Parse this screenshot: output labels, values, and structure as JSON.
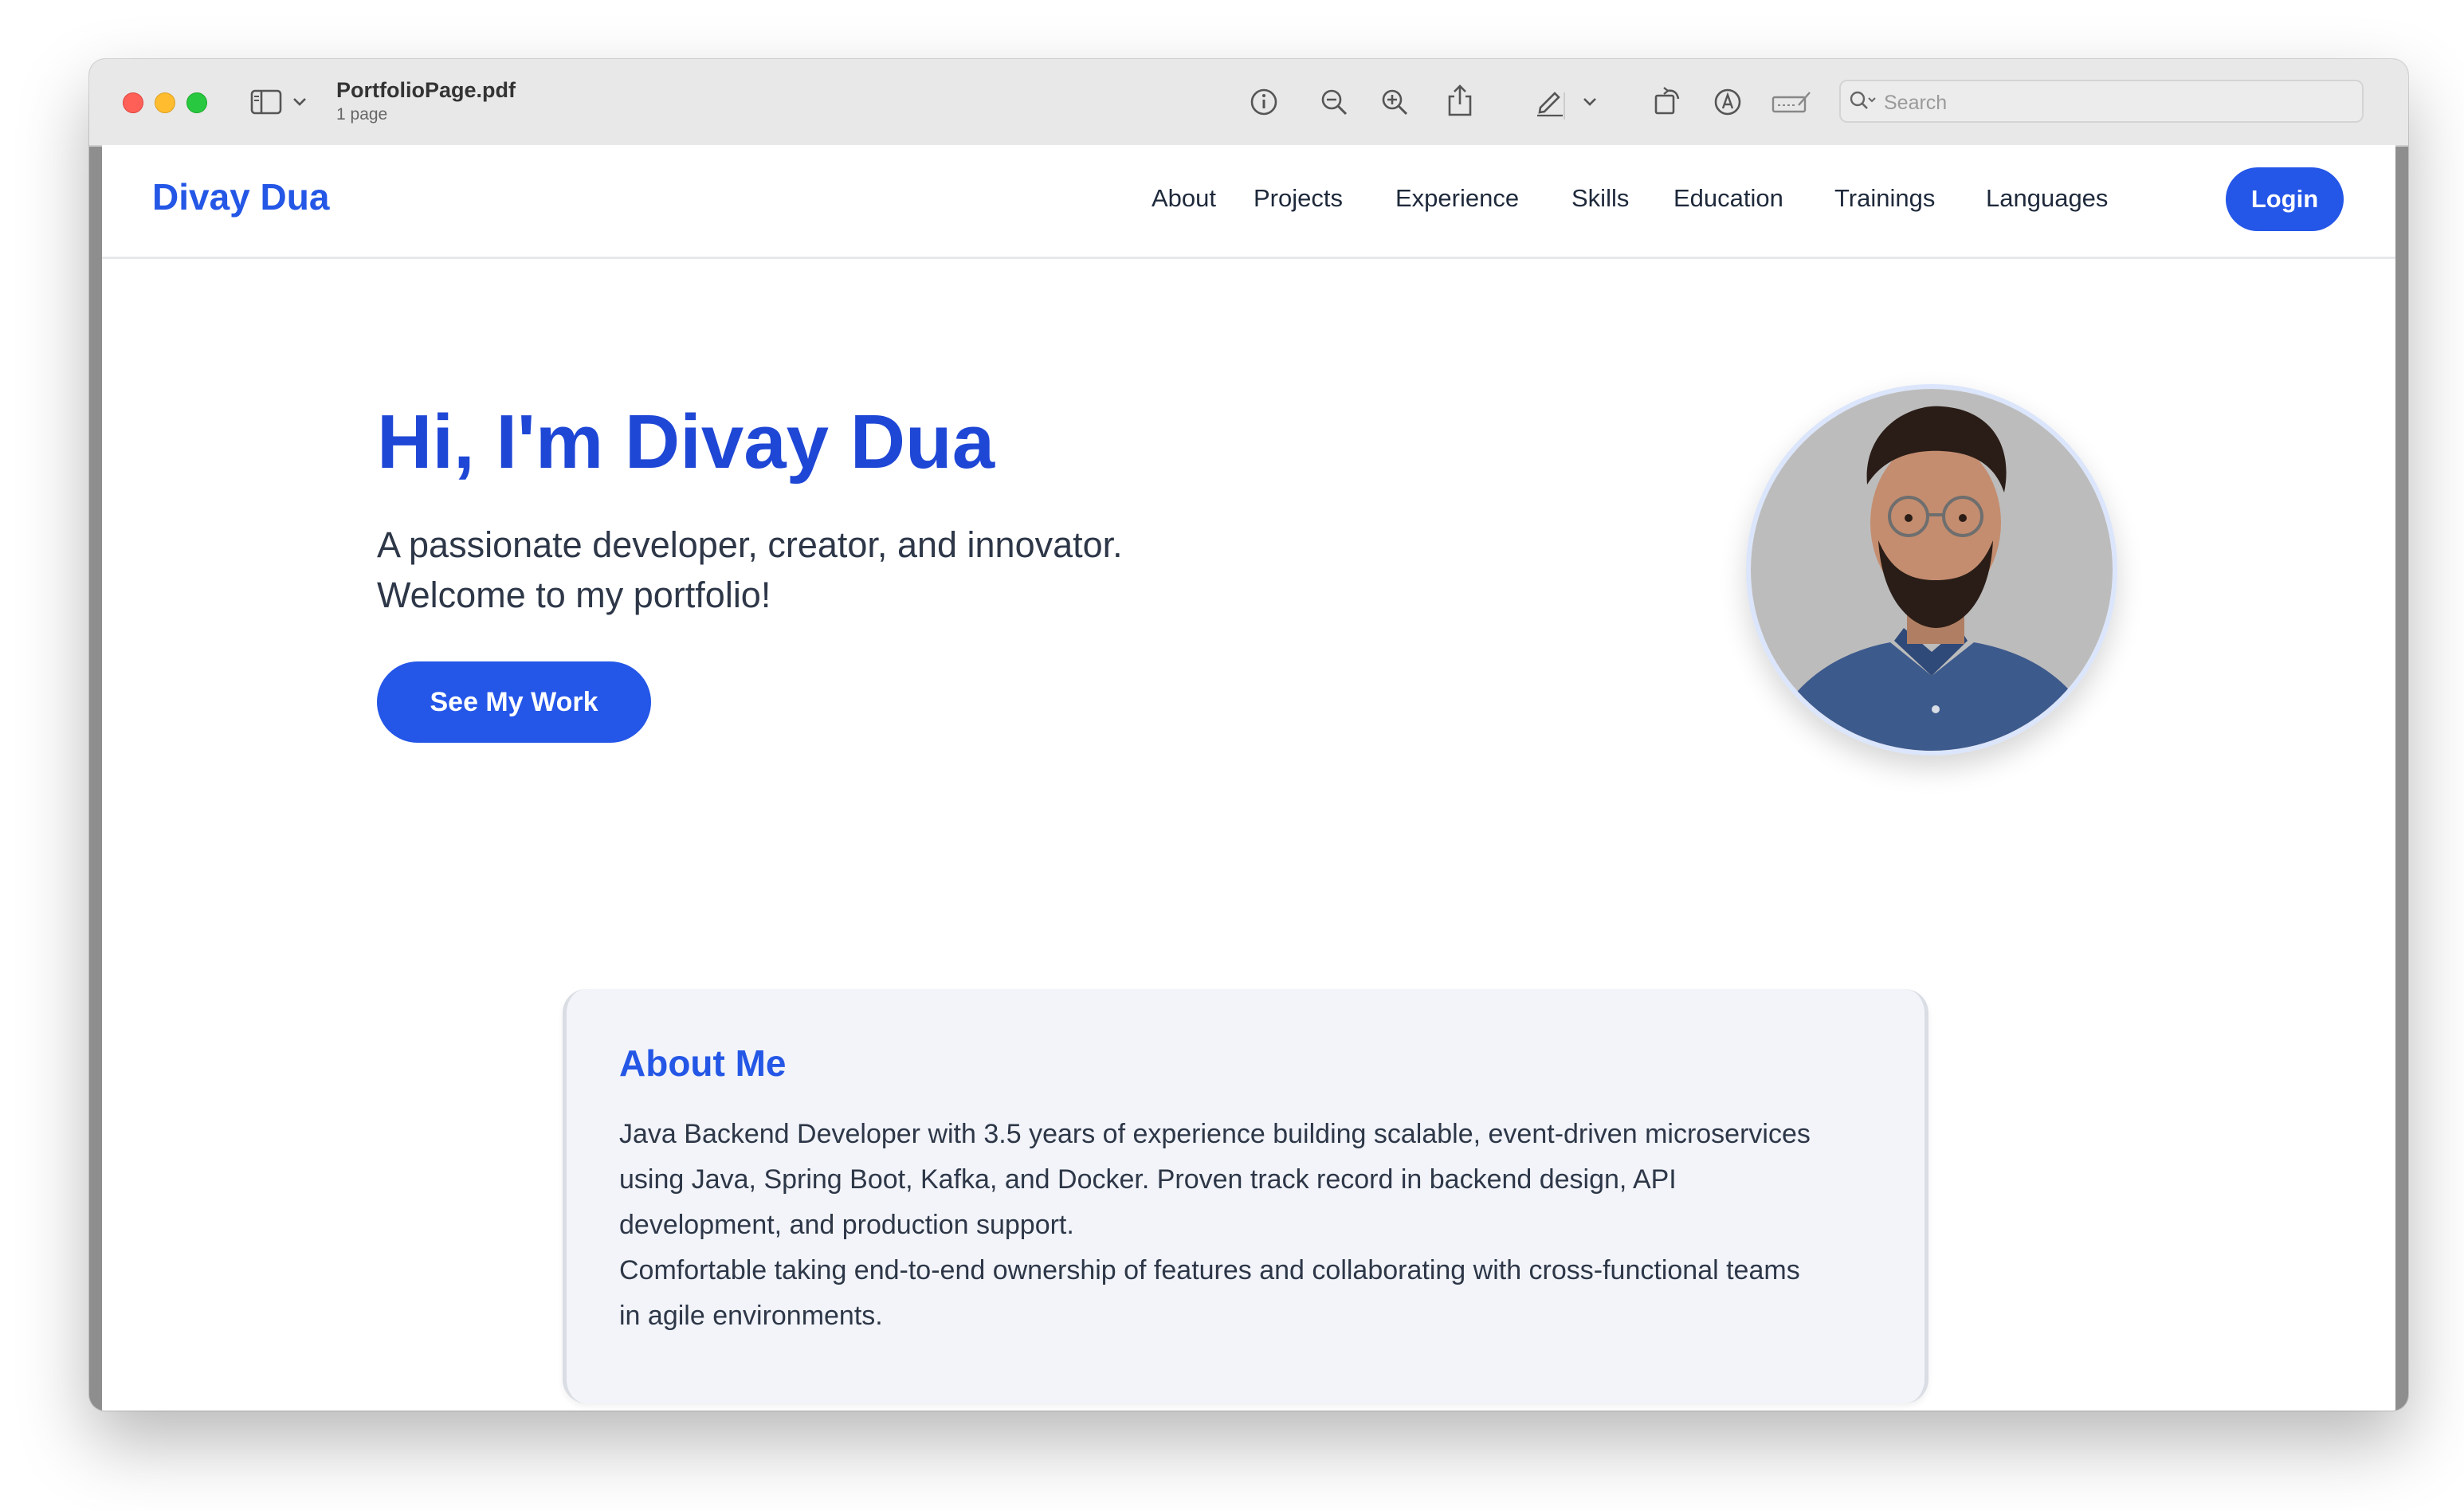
{
  "window": {
    "doc_title": "PortfolioPage.pdf",
    "doc_subtitle": "1 page",
    "search_placeholder": "Search",
    "toolbar_icons": [
      "sidebar-icon",
      "chevron-down-icon",
      "info-icon",
      "zoom-out-icon",
      "zoom-in-icon",
      "share-icon",
      "pencil-icon",
      "chevron-down-icon",
      "rotate-icon",
      "markup-icon",
      "form-icon",
      "search-icon"
    ]
  },
  "site": {
    "logo": "Divay Dua",
    "nav": [
      "About",
      "Projects",
      "Experience",
      "Skills",
      "Education",
      "Trainings",
      "Languages"
    ],
    "login": "Login"
  },
  "hero": {
    "title": "Hi, I'm Divay Dua",
    "subtitle_line1": "A passionate developer, creator, and innovator.",
    "subtitle_line2": "Welcome to my portfolio!",
    "cta": "See My Work"
  },
  "about": {
    "title": "About Me",
    "line1": "Java Backend Developer with 3.5 years of experience building scalable, event-driven microservices",
    "line2": "using Java, Spring Boot, Kafka, and Docker. Proven track record in backend design, API",
    "line3": "development, and production support.",
    "line4": "Comfortable taking end-to-end ownership of features and collaborating with cross-functional teams",
    "line5": "in agile environments."
  },
  "colors": {
    "accent": "#2456e8",
    "heading": "#1f47d6",
    "text": "#2d3748",
    "card_bg": "#f2f4f9"
  }
}
